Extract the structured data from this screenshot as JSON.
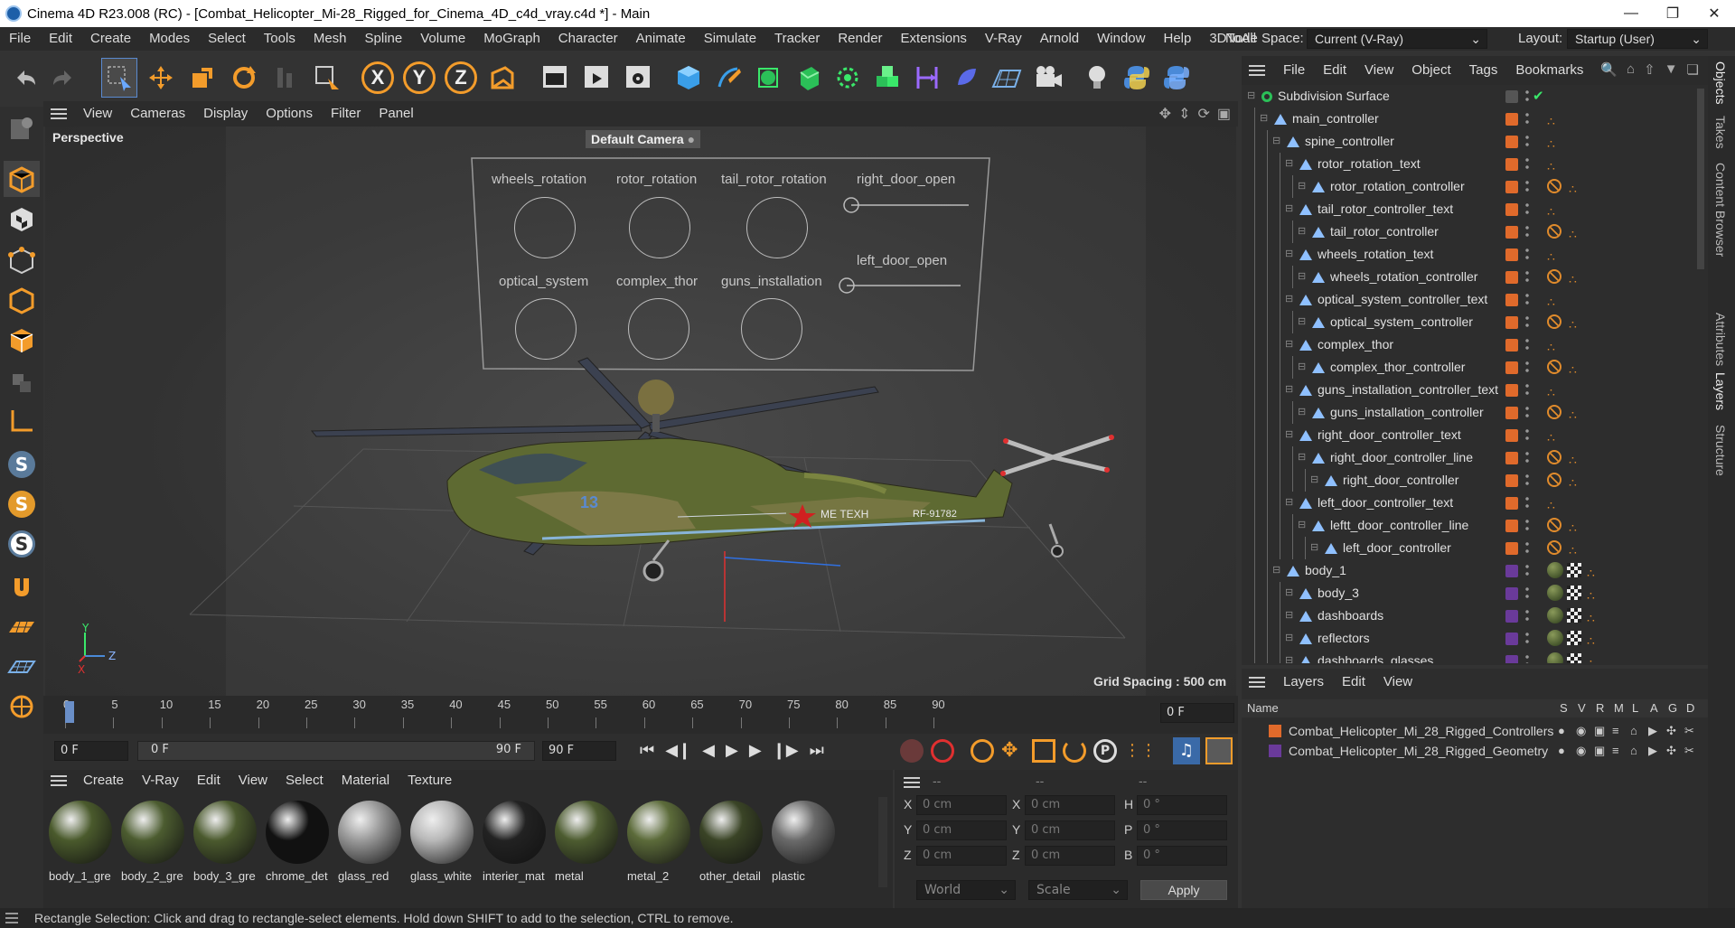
{
  "window": {
    "title": "Cinema 4D R23.008 (RC) - [Combat_Helicopter_Mi-28_Rigged_for_Cinema_4D_c4d_vray.c4d *] - Main"
  },
  "menubar": {
    "items": [
      "File",
      "Edit",
      "Create",
      "Modes",
      "Select",
      "Tools",
      "Mesh",
      "Spline",
      "Volume",
      "MoGraph",
      "Character",
      "Animate",
      "Simulate",
      "Tracker",
      "Render",
      "Extensions",
      "V-Ray",
      "Arnold",
      "Window",
      "Help",
      "3DToAll"
    ],
    "node_space_label": "Node Space:",
    "node_space_value": "Current (V-Ray)",
    "layout_label": "Layout:",
    "layout_value": "Startup (User)"
  },
  "viewport_menu": {
    "items": [
      "View",
      "Cameras",
      "Display",
      "Options",
      "Filter",
      "Panel"
    ]
  },
  "viewport": {
    "view_name": "Perspective",
    "camera_name": "Default Camera",
    "grid_spacing": "Grid Spacing : 500 cm",
    "axis_y": "Y",
    "axis_z": "Z",
    "axis_x": "X",
    "controllers": {
      "wheels_rotation": "wheels_rotation",
      "rotor_rotation": "rotor_rotation",
      "tail_rotor_rotation": "tail_rotor_rotation",
      "right_door_open": "right_door_open",
      "left_door_open": "left_door_open",
      "optical_system": "optical_system",
      "complex_thor": "complex_thor",
      "guns_installation": "guns_installation"
    },
    "heli_text1": "МЕ ТЕХН",
    "heli_text2": "RF-91782",
    "heli_number": "13"
  },
  "timeline": {
    "ticks": [
      "0",
      "5",
      "10",
      "15",
      "20",
      "25",
      "30",
      "35",
      "40",
      "45",
      "50",
      "55",
      "60",
      "65",
      "70",
      "75",
      "80",
      "85",
      "90"
    ],
    "current_frame": "0 F"
  },
  "transport": {
    "start_frame": "0 F",
    "range_start": "0 F",
    "range_end": "90 F",
    "end_frame": "90 F"
  },
  "material_manager": {
    "menu": [
      "Create",
      "V-Ray",
      "Edit",
      "View",
      "Select",
      "Material",
      "Texture"
    ],
    "materials": [
      {
        "name": "body_1_gre",
        "color": "#4a5a2c"
      },
      {
        "name": "body_2_gre",
        "color": "#4c5c30"
      },
      {
        "name": "body_3_gre",
        "color": "#4b5a2e"
      },
      {
        "name": "chrome_det",
        "color": "#111111"
      },
      {
        "name": "glass_red",
        "color": "#9a9a9a"
      },
      {
        "name": "glass_white",
        "color": "#b8b8b8"
      },
      {
        "name": "interier_mat",
        "color": "#222222"
      },
      {
        "name": "metal",
        "color": "#4d5c30"
      },
      {
        "name": "metal_2",
        "color": "#5c6b3a"
      },
      {
        "name": "other_detail",
        "color": "#3a4426"
      },
      {
        "name": "plastic",
        "color": "#6a6a6a"
      }
    ]
  },
  "coordinates": {
    "header": [
      "--",
      "--",
      "--"
    ],
    "rows": [
      {
        "a": "X",
        "av": "0 cm",
        "b": "X",
        "bv": "0 cm",
        "c": "H",
        "cv": "0 °"
      },
      {
        "a": "Y",
        "av": "0 cm",
        "b": "Y",
        "bv": "0 cm",
        "c": "P",
        "cv": "0 °"
      },
      {
        "a": "Z",
        "av": "0 cm",
        "b": "Z",
        "bv": "0 cm",
        "c": "B",
        "cv": "0 °"
      }
    ],
    "mode1": "World",
    "mode2": "Scale",
    "apply": "Apply"
  },
  "object_manager": {
    "menu": [
      "File",
      "Edit",
      "View",
      "Object",
      "Tags",
      "Bookmarks"
    ],
    "objects": [
      {
        "name": "Subdivision Surface",
        "indent": 0,
        "color": "",
        "tag": "check"
      },
      {
        "name": "main_controller",
        "indent": 1,
        "color": "#e06a2b",
        "tag": "dots"
      },
      {
        "name": "spine_controller",
        "indent": 2,
        "color": "#e06a2b",
        "tag": "dots"
      },
      {
        "name": "rotor_rotation_text",
        "indent": 3,
        "color": "#e06a2b",
        "tag": "dots"
      },
      {
        "name": "rotor_rotation_controller",
        "indent": 4,
        "color": "#e06a2b",
        "tag": "nodots"
      },
      {
        "name": "tail_rotor_controller_text",
        "indent": 3,
        "color": "#e06a2b",
        "tag": "dots"
      },
      {
        "name": "tail_rotor_controller",
        "indent": 4,
        "color": "#e06a2b",
        "tag": "nodots"
      },
      {
        "name": "wheels_rotation_text",
        "indent": 3,
        "color": "#e06a2b",
        "tag": "dots"
      },
      {
        "name": "wheels_rotation_controller",
        "indent": 4,
        "color": "#e06a2b",
        "tag": "nodots"
      },
      {
        "name": "optical_system_controller_text",
        "indent": 3,
        "color": "#e06a2b",
        "tag": "dots"
      },
      {
        "name": "optical_system_controller",
        "indent": 4,
        "color": "#e06a2b",
        "tag": "nodots"
      },
      {
        "name": "complex_thor",
        "indent": 3,
        "color": "#e06a2b",
        "tag": "dots"
      },
      {
        "name": "complex_thor_controller",
        "indent": 4,
        "color": "#e06a2b",
        "tag": "nodots"
      },
      {
        "name": "guns_installation_controller_text",
        "indent": 3,
        "color": "#e06a2b",
        "tag": "dots"
      },
      {
        "name": "guns_installation_controller",
        "indent": 4,
        "color": "#e06a2b",
        "tag": "nodots"
      },
      {
        "name": "right_door_controller_text",
        "indent": 3,
        "color": "#e06a2b",
        "tag": "dots"
      },
      {
        "name": "right_door_controller_line",
        "indent": 4,
        "color": "#e06a2b",
        "tag": "nodots"
      },
      {
        "name": "right_door_controller",
        "indent": 5,
        "color": "#e06a2b",
        "tag": "nodots"
      },
      {
        "name": "left_door_controller_text",
        "indent": 3,
        "color": "#e06a2b",
        "tag": "dots"
      },
      {
        "name": "leftt_door_controller_line",
        "indent": 4,
        "color": "#e06a2b",
        "tag": "nodots"
      },
      {
        "name": "left_door_controller",
        "indent": 5,
        "color": "#e06a2b",
        "tag": "nodots"
      },
      {
        "name": "body_1",
        "indent": 2,
        "color": "#6a3a9a",
        "tag": "mat"
      },
      {
        "name": "body_3",
        "indent": 3,
        "color": "#6a3a9a",
        "tag": "mat"
      },
      {
        "name": "dashboards",
        "indent": 3,
        "color": "#6a3a9a",
        "tag": "mat"
      },
      {
        "name": "reflectors",
        "indent": 3,
        "color": "#6a3a9a",
        "tag": "mat"
      },
      {
        "name": "dashboards_glasses",
        "indent": 3,
        "color": "#6a3a9a",
        "tag": "mat"
      }
    ]
  },
  "layer_manager": {
    "menu": [
      "Layers",
      "Edit",
      "View"
    ],
    "name_header": "Name",
    "col_headers": [
      "S",
      "V",
      "R",
      "M",
      "L",
      "A",
      "G",
      "D"
    ],
    "layers": [
      {
        "name": "Combat_Helicopter_Mi_28_Rigged_Controllers",
        "color": "#e06a2b"
      },
      {
        "name": "Combat_Helicopter_Mi_28_Rigged_Geometry",
        "color": "#6a3a9a"
      }
    ]
  },
  "right_tabs": [
    "Objects",
    "Takes",
    "Content Browser",
    "Attributes",
    "Layers",
    "Structure"
  ],
  "status": "Rectangle Selection: Click and drag to rectangle-select elements. Hold down SHIFT to add to the selection, CTRL to remove."
}
